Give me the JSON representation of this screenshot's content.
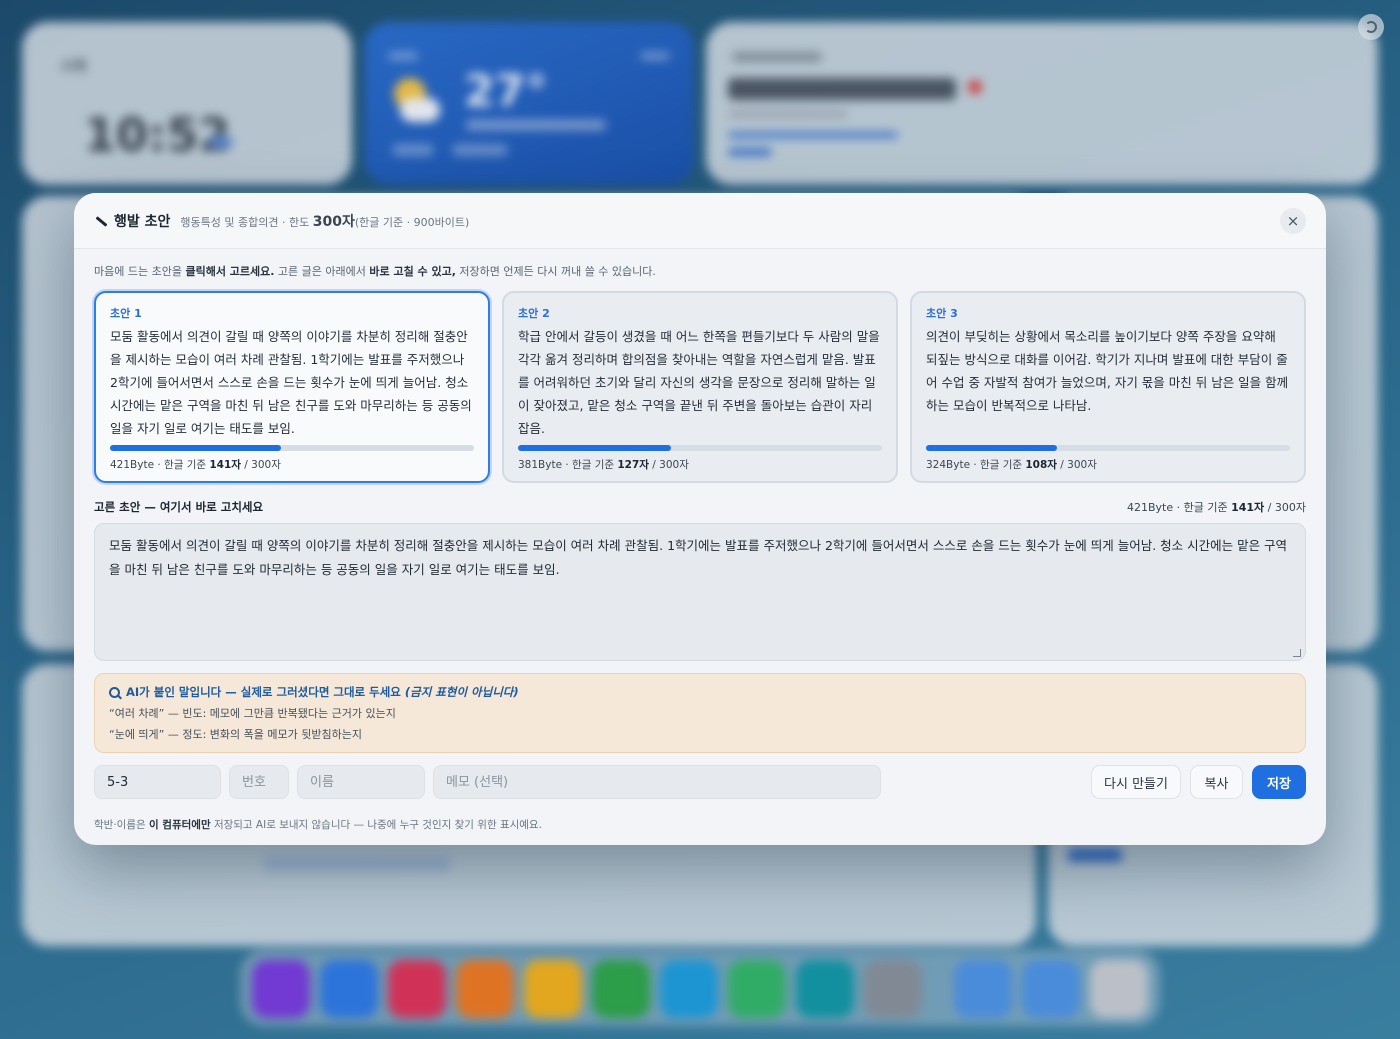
{
  "background": {
    "clock_label": "시계",
    "clock_time": "10:52",
    "weather_temp": "27°"
  },
  "modal": {
    "title": "행발 초안",
    "subtitle_prefix": "행동특성 및 종합의견 · 한도 ",
    "subtitle_limit": "300자",
    "subtitle_suffix": "(한글 기준 · 900바이트)",
    "close_glyph": "×",
    "instruction": {
      "p1": "마음에 드는 초안을 ",
      "b1": "클릭해서 고르세요.",
      "p2": " 고른 글은 아래에서 ",
      "b2": "바로 고칠 수 있고,",
      "p3": " 저장하면 언제든 다시 꺼내 쓸 수 있습니다."
    },
    "drafts": [
      {
        "label": "초안 1",
        "text": "모둠 활동에서 의견이 갈릴 때 양쪽의 이야기를 차분히 정리해 절충안을 제시하는 모습이 여러 차례 관찰됨. 1학기에는 발표를 주저했으나 2학기에 들어서면서 스스로 손을 드는 횟수가 눈에 띄게 늘어남. 청소 시간에는 맡은 구역을 마친 뒤 남은 친구를 도와 마무리하는 등 공동의 일을 자기 일로 여기는 태도를 보임.",
        "bytes": "421Byte · 한글 기준 ",
        "chars": "141자",
        "limit": " / 300자",
        "fill": 0.47,
        "selected": true
      },
      {
        "label": "초안 2",
        "text": "학급 안에서 갈등이 생겼을 때 어느 한쪽을 편들기보다 두 사람의 말을 각각 옮겨 정리하며 합의점을 찾아내는 역할을 자연스럽게 맡음. 발표를 어려워하던 초기와 달리 자신의 생각을 문장으로 정리해 말하는 일이 잦아졌고, 맡은 청소 구역을 끝낸 뒤 주변을 돌아보는 습관이 자리 잡음.",
        "bytes": "381Byte · 한글 기준 ",
        "chars": "127자",
        "limit": " / 300자",
        "fill": 0.42,
        "selected": false
      },
      {
        "label": "초안 3",
        "text": "의견이 부딪히는 상황에서 목소리를 높이기보다 양쪽 주장을 요약해 되짚는 방식으로 대화를 이어감. 학기가 지나며 발표에 대한 부담이 줄어 수업 중 자발적 참여가 늘었으며, 자기 몫을 마친 뒤 남은 일을 함께 하는 모습이 반복적으로 나타남.",
        "bytes": "324Byte · 한글 기준 ",
        "chars": "108자",
        "limit": " / 300자",
        "fill": 0.36,
        "selected": false
      }
    ],
    "editor": {
      "title": "고른 초안 — 여기서 바로 고치세요",
      "count_prefix": "421Byte · 한글 기준 ",
      "count_chars": "141자",
      "count_limit": " / 300자",
      "value": "모둠 활동에서 의견이 갈릴 때 양쪽의 이야기를 차분히 정리해 절충안을 제시하는 모습이 여러 차례 관찰됨. 1학기에는 발표를 주저했으나 2학기에 들어서면서 스스로 손을 드는 횟수가 눈에 띄게 늘어남. 청소 시간에는 맡은 구역을 마친 뒤 남은 친구를 도와 마무리하는 등 공동의 일을 자기 일로 여기는 태도를 보임."
    },
    "ai_note": {
      "title": "AI가 붙인 말입니다 — 실제로 그러셨다면 그대로 두세요",
      "title_em": "(금지 표현이 아닙니다)",
      "lines": [
        "“여러 차례” — 빈도: 메모에 그만큼 반복됐다는 근거가 있는지",
        "“눈에 띄게” — 정도: 변화의 폭을 메모가 뒷받침하는지"
      ]
    },
    "inputs": {
      "class_value": "5-3",
      "number_placeholder": "번호",
      "name_placeholder": "이름",
      "memo_placeholder": "메모 (선택)"
    },
    "buttons": {
      "regenerate": "다시 만들기",
      "copy": "복사",
      "save": "저장"
    },
    "footnote": {
      "p1": "학반·이름은 ",
      "b1": "이 컴퓨터에만",
      "p2": " 저장되고 AI로 보내지 않습니다 — 나중에 누구 것인지 찾기 위한 표시예요."
    }
  }
}
